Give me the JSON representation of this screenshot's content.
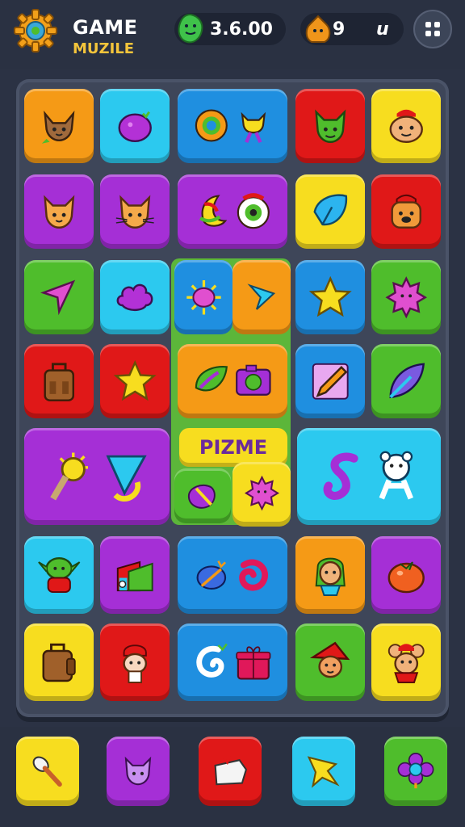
{
  "header": {
    "title": "GAME",
    "subtitle": "MUZILE",
    "currency_value": "3.6.00",
    "lives_value": "9",
    "extra_label": "u",
    "gear_icon": "gear-icon",
    "gem_icon": "green-gem-icon",
    "bag_icon": "coin-bag-icon",
    "menu_icon": "menu-icon"
  },
  "board": {
    "center_label": "PIZME",
    "tiles": [
      {
        "icon": "fox-icon",
        "color": "orange"
      },
      {
        "icon": "purple-fruit-icon",
        "color": "cyan"
      },
      {
        "icon": "ring-and-cat-icon",
        "color": "blue"
      },
      {
        "icon": "green-cat-icon",
        "color": "red"
      },
      {
        "icon": "hamster-icon",
        "color": "yellow"
      },
      {
        "icon": "cat-face-icon",
        "color": "purple"
      },
      {
        "icon": "cat-whiskers-icon",
        "color": "purple"
      },
      {
        "icon": "moon-and-eye-icon",
        "color": "purple"
      },
      {
        "icon": "blue-leaf-icon",
        "color": "yellow"
      },
      {
        "icon": "bear-icon",
        "color": "red"
      },
      {
        "icon": "pink-arrow-icon",
        "color": "green"
      },
      {
        "icon": "purple-cloud-icon",
        "color": "cyan"
      },
      {
        "icon": "pink-sun-icon",
        "color": "blue"
      },
      {
        "icon": "blue-arrow-icon",
        "color": "orange"
      },
      {
        "icon": "star-icon",
        "color": "blue"
      },
      {
        "icon": "pink-spiky-icon",
        "color": "green"
      },
      {
        "icon": "backpack-icon",
        "color": "red"
      },
      {
        "icon": "star-icon",
        "color": "red"
      },
      {
        "icon": "leaf-and-camera-icon",
        "color": "orange"
      },
      {
        "icon": "pencil-icon",
        "color": "blue"
      },
      {
        "icon": "blue-feather-icon",
        "color": "green"
      },
      {
        "icon": "sun-wand-and-pennant-icon",
        "color": "purple"
      },
      {
        "icon": "purple-gem-icon",
        "color": "green"
      },
      {
        "icon": "pink-sun-icon",
        "color": "yellow"
      },
      {
        "icon": "squiggle-and-bear-icon",
        "color": "cyan"
      },
      {
        "icon": "goblin-icon",
        "color": "cyan"
      },
      {
        "icon": "chart-icon",
        "color": "purple"
      },
      {
        "icon": "bird-and-swirl-icon",
        "color": "blue"
      },
      {
        "icon": "girl-braids-icon",
        "color": "orange"
      },
      {
        "icon": "tomato-icon",
        "color": "purple"
      },
      {
        "icon": "luggage-icon",
        "color": "yellow"
      },
      {
        "icon": "chef-icon",
        "color": "red"
      },
      {
        "icon": "swirl-and-gift-icon",
        "color": "blue"
      },
      {
        "icon": "gnome-icon",
        "color": "green"
      },
      {
        "icon": "mouse-icon",
        "color": "yellow"
      }
    ]
  },
  "tray": [
    {
      "icon": "spoon-icon",
      "color": "yellow"
    },
    {
      "icon": "purple-cat-icon",
      "color": "purple"
    },
    {
      "icon": "white-cloth-icon",
      "color": "red"
    },
    {
      "icon": "yellow-star-icon",
      "color": "cyan"
    },
    {
      "icon": "purple-flower-icon",
      "color": "green"
    }
  ]
}
